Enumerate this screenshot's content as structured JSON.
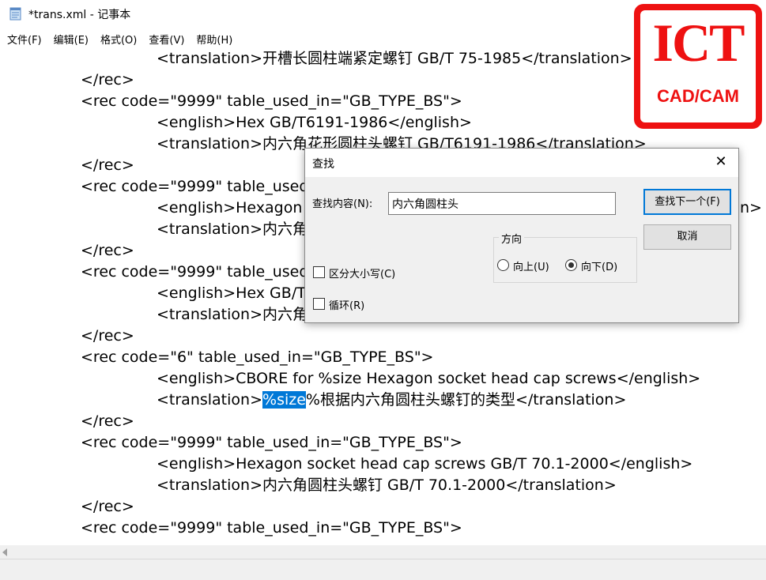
{
  "window": {
    "title": "*trans.xml - 记事本"
  },
  "menu": [
    "文件(F)",
    "编辑(E)",
    "格式(O)",
    "查看(V)",
    "帮助(H)"
  ],
  "logo": {
    "main": "ICT",
    "sub": "CAD/CAM",
    "color": "#ee1111"
  },
  "editor": {
    "lines": [
      "<translation>开槽长圆柱端紧定螺钉 GB/T 75-1985</translation>",
      "</rec>",
      "<rec code=\"9999\" table_used_in=\"GB_TYPE_BS\">",
      "<english>Hex GB/T6191-1986</english>",
      "<translation>内六角花形圆柱头螺钉 GB/T6191-1986</translation>",
      "</rec>",
      "<rec code=\"9999\" table_used",
      "<english>Hexagon",
      "<translation>内六角",
      "</rec>",
      "<rec code=\"9999\" table_used",
      "<english>Hex GB/T",
      "<translation>内六角",
      "</rec>",
      "<rec code=\"6\" table_used_in=\"GB_TYPE_BS\">",
      "<english>CBORE for %size Hexagon socket head cap screws</english>",
      "<translation>",
      "</rec>",
      "<rec code=\"9999\" table_used_in=\"GB_TYPE_BS\">",
      "<english>Hexagon socket head cap screws GB/T 70.1-2000</english>",
      "<translation>内六角圆柱头螺钉 GB/T 70.1-2000</translation>",
      "</rec>",
      "<rec code=\"9999\" table_used_in=\"GB_TYPE_BS\">"
    ],
    "line8_tail": "n>",
    "selected_text": "%size",
    "after_selection": "%根据内六角圆柱头螺钉的类型</translation>",
    "selection_color": "#0078d7"
  },
  "find_dialog": {
    "title": "查找",
    "close": "✕",
    "find_label": "查找内容(N):",
    "find_value": "内六角圆柱头",
    "find_next": "查找下一个(F)",
    "cancel": "取消",
    "direction_label": "方向",
    "up": "向上(U)",
    "down": "向下(D)",
    "direction_selected": "down",
    "match_case": "区分大小写(C)",
    "wrap": "循环(R)",
    "match_case_checked": false,
    "wrap_checked": false
  }
}
